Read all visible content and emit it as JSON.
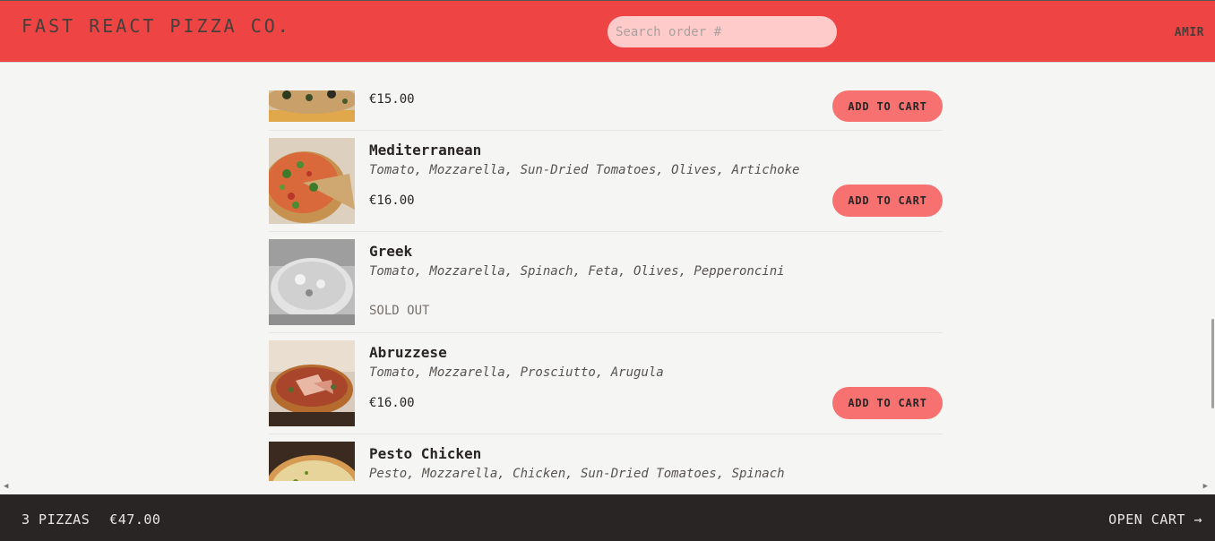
{
  "header": {
    "logo": "FAST REACT PIZZA CO.",
    "search_placeholder": "Search order #",
    "username": "AMIR"
  },
  "menu": {
    "items": [
      {
        "name": "",
        "ingredients": "",
        "price": "€15.00",
        "action": "ADD TO CART",
        "sold_out": false
      },
      {
        "name": "Mediterranean",
        "ingredients": "Tomato, Mozzarella, Sun-Dried Tomatoes, Olives, Artichoke",
        "price": "€16.00",
        "action": "ADD TO CART",
        "sold_out": false
      },
      {
        "name": "Greek",
        "ingredients": "Tomato, Mozzarella, Spinach, Feta, Olives, Pepperoncini",
        "status": "SOLD OUT",
        "sold_out": true
      },
      {
        "name": "Abruzzese",
        "ingredients": "Tomato, Mozzarella, Prosciutto, Arugula",
        "price": "€16.00",
        "action": "ADD TO CART",
        "sold_out": false
      },
      {
        "name": "Pesto Chicken",
        "ingredients": "Pesto, Mozzarella, Chicken, Sun-Dried Tomatoes, Spinach",
        "sold_out": false
      }
    ]
  },
  "cart": {
    "count": "3 PIZZAS",
    "total": "€47.00",
    "open_label": "OPEN CART →"
  },
  "colors": {
    "header_bg": "#ef4444",
    "button_bg": "#f87171",
    "footer_bg": "#292524",
    "page_bg": "#f5f5f4"
  }
}
